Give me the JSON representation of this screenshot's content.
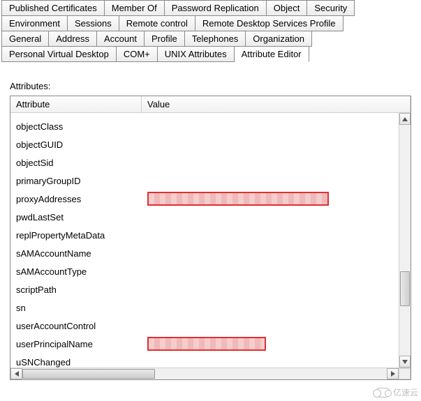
{
  "tabs": {
    "row1": [
      "Published Certificates",
      "Member Of",
      "Password Replication",
      "Object",
      "Security"
    ],
    "row2": [
      "Environment",
      "Sessions",
      "Remote control",
      "Remote Desktop Services Profile"
    ],
    "row3": [
      "General",
      "Address",
      "Account",
      "Profile",
      "Telephones",
      "Organization"
    ],
    "row4": [
      "Personal Virtual Desktop",
      "COM+",
      "UNIX Attributes",
      "Attribute Editor"
    ],
    "active": "Attribute Editor"
  },
  "section_label": "Attributes:",
  "columns": {
    "attribute": "Attribute",
    "value": "Value"
  },
  "rows": [
    {
      "attr": "objectClass",
      "val": ""
    },
    {
      "attr": "objectGUID",
      "val": ""
    },
    {
      "attr": "objectSid",
      "val": ""
    },
    {
      "attr": "primaryGroupID",
      "val": ""
    },
    {
      "attr": "proxyAddresses",
      "val": "",
      "redacted": "wide"
    },
    {
      "attr": "pwdLastSet",
      "val": ""
    },
    {
      "attr": "replPropertyMetaData",
      "val": ""
    },
    {
      "attr": "sAMAccountName",
      "val": ""
    },
    {
      "attr": "sAMAccountType",
      "val": ""
    },
    {
      "attr": "scriptPath",
      "val": ""
    },
    {
      "attr": "sn",
      "val": ""
    },
    {
      "attr": "userAccountControl",
      "val": ""
    },
    {
      "attr": "userPrincipalName",
      "val": "",
      "redacted": "mid"
    },
    {
      "attr": "uSNChanged",
      "val": ""
    }
  ],
  "watermark": "亿速云"
}
